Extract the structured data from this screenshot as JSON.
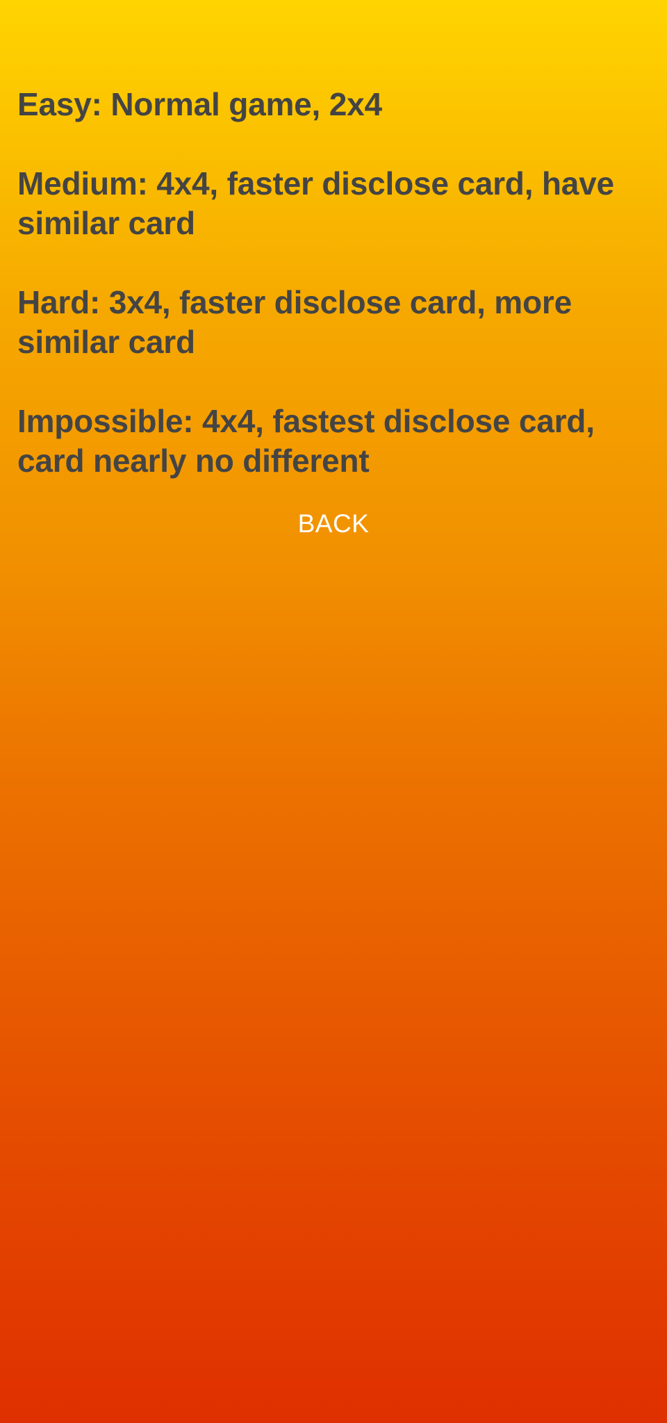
{
  "instructions": {
    "easy": "Easy: Normal game, 2x4",
    "medium": "Medium: 4x4, faster disclose card, have similar card",
    "hard": "Hard: 3x4, faster disclose card, more similar card",
    "impossible": "Impossible: 4x4, fastest disclose card, card nearly no different"
  },
  "back_button": {
    "label": "BACK"
  },
  "colors": {
    "gradient_top": "#FFD400",
    "gradient_bottom": "#DF2F00",
    "text": "#444444",
    "button_text": "#FFFFFF"
  }
}
